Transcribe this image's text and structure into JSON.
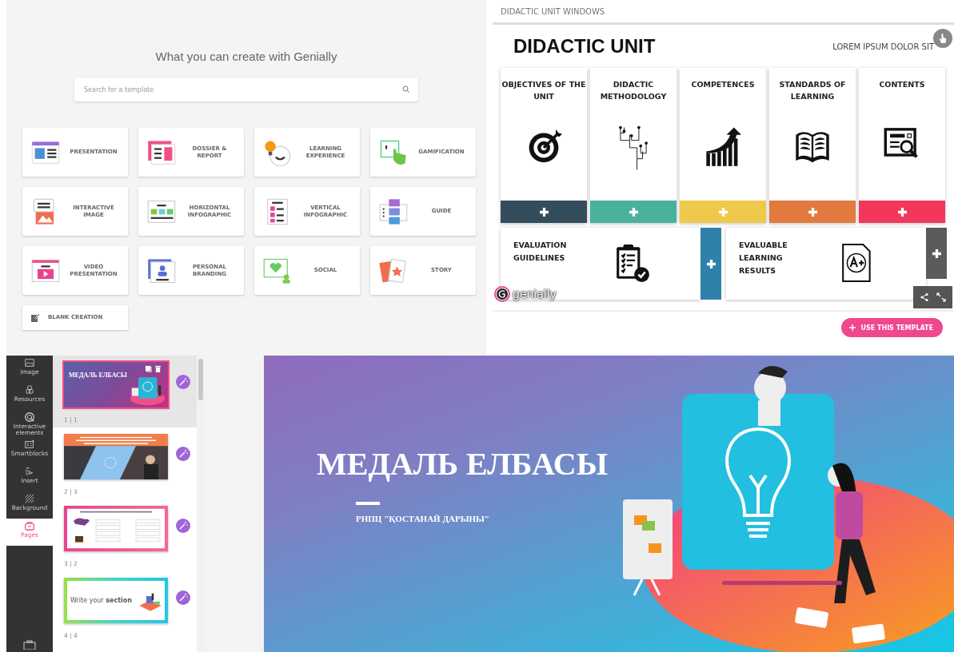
{
  "gallery": {
    "title": "What you can create with Genially",
    "search": {
      "placeholder": "Search for a template"
    },
    "templates": [
      {
        "label": "PRESENTATION"
      },
      {
        "label": "DOSSIER & REPORT"
      },
      {
        "label": "LEARNING EXPERIENCE"
      },
      {
        "label": "GAMIFICATION"
      },
      {
        "label": "INTERACTIVE IMAGE"
      },
      {
        "label": "HORIZONTAL INFOGRAPHIC"
      },
      {
        "label": "VERTICAL INFOGRAPHIC"
      },
      {
        "label": "GUIDE"
      },
      {
        "label": "VIDEO PRESENTATION"
      },
      {
        "label": "PERSONAL BRANDING"
      },
      {
        "label": "SOCIAL"
      },
      {
        "label": "STORY"
      }
    ],
    "blank": {
      "label": "BLANK CREATION"
    }
  },
  "preview": {
    "header": "DIDACTIC UNIT WINDOWS",
    "title": "DIDACTIC UNIT",
    "subtitle": "LOREM IPSUM DOLOR SIT",
    "sections": [
      {
        "label": "OBJECTIVES OF THE UNIT",
        "color": "#344d5c"
      },
      {
        "label": "DIDACTIC METHODOLOGY",
        "color": "#4ab19d"
      },
      {
        "label": "COMPETENCES",
        "color": "#efc94c"
      },
      {
        "label": "STANDARDS OF LEARNING",
        "color": "#e27a3f"
      },
      {
        "label": "CONTENTS",
        "color": "#f2385a"
      }
    ],
    "wide_sections": [
      {
        "label": "EVALUATION GUIDELINES",
        "color": "#2e81a8"
      },
      {
        "label": "EVALUABLE LEARNING RESULTS",
        "color": "#5b5b5b"
      }
    ],
    "logo": "genially",
    "cta": "USE THIS TEMPLATE"
  },
  "editor": {
    "tools": [
      {
        "label": "Image",
        "selected": false
      },
      {
        "label": "Resources",
        "selected": false
      },
      {
        "label": "Interactive elements",
        "selected": false
      },
      {
        "label": "Smartblocks",
        "selected": false
      },
      {
        "label": "Insert",
        "selected": false
      },
      {
        "label": "Background",
        "selected": false
      },
      {
        "label": "Pages",
        "selected": true
      }
    ],
    "pages": [
      {
        "number": "1 | 1",
        "selected": true,
        "title": "МЕДАЛЬ ЕЛБАСЫ"
      },
      {
        "number": "2 | 3",
        "selected": false
      },
      {
        "number": "3 | 2",
        "selected": false
      },
      {
        "number": "4 | 4",
        "selected": false,
        "title": "Write your **section**"
      }
    ],
    "slide": {
      "title": "МЕДАЛЬ ЕЛБАСЫ",
      "subtitle": "РНПЦ \"ҚОСТАНАЙ ДАРЫНЫ\""
    }
  }
}
